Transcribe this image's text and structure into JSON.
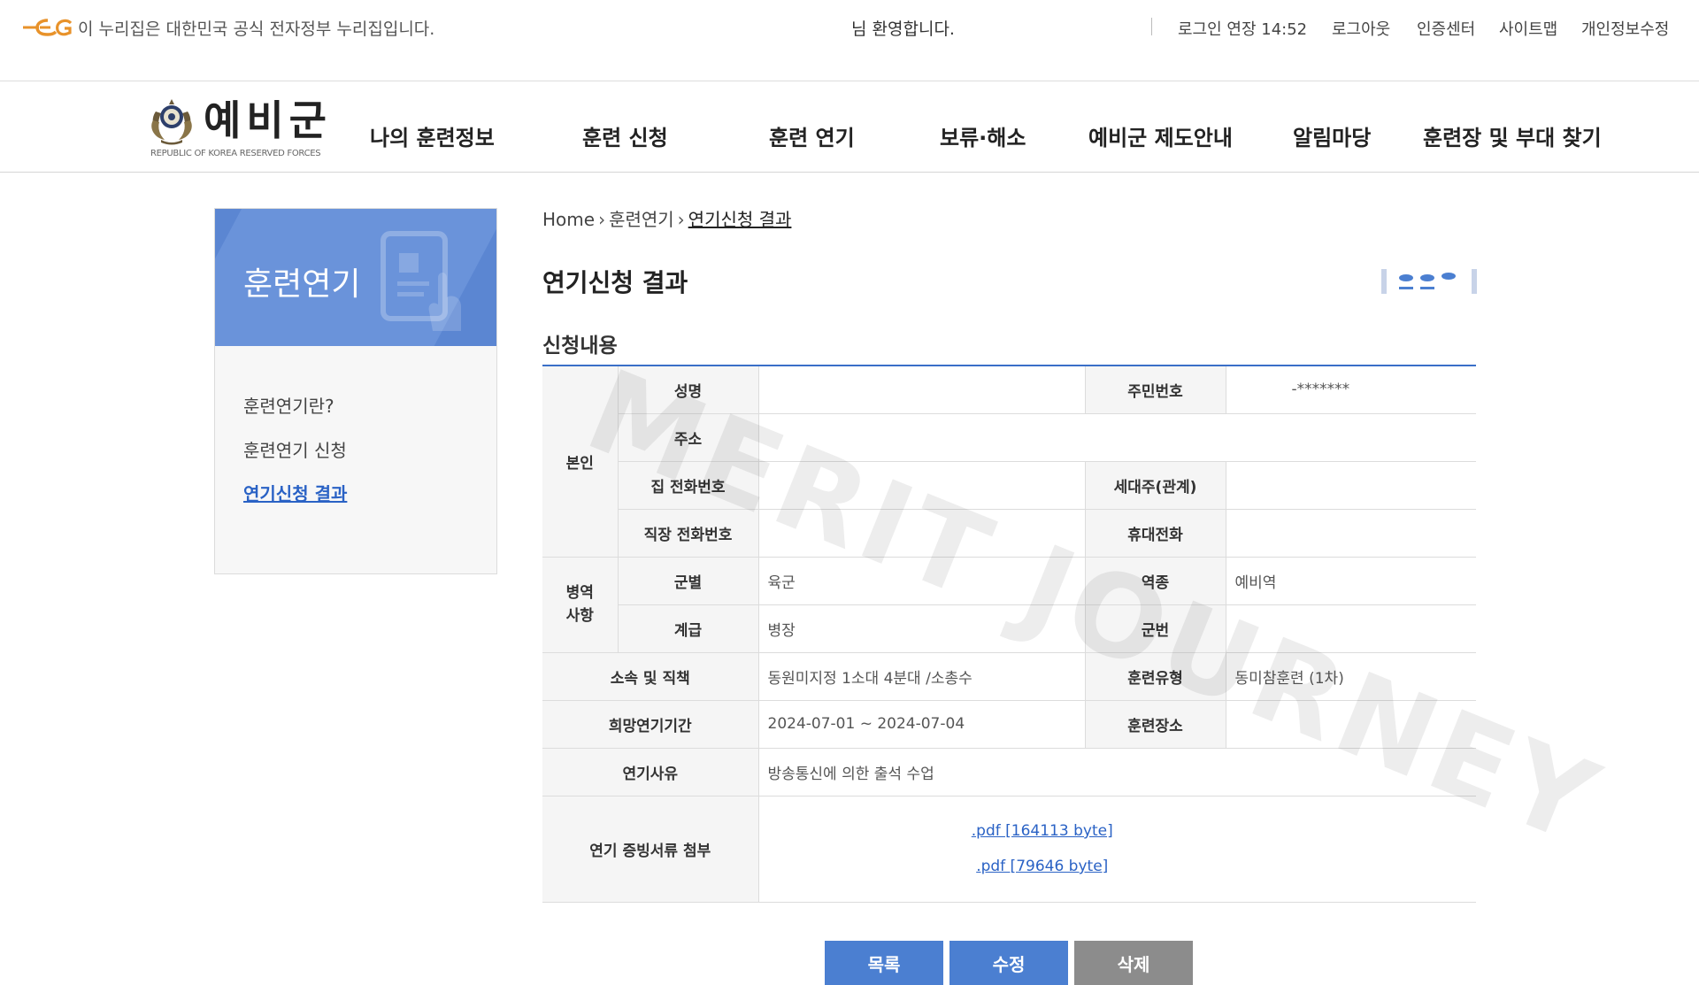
{
  "topbar": {
    "gov_notice": "이 누리집은 대한민국 공식 전자정부 누리집입니다.",
    "welcome": "님 환영합니다.",
    "login_extend": "로그인 연장 14:52",
    "logout": "로그아웃",
    "cert_center": "인증센터",
    "sitemap": "사이트맵",
    "edit_profile": "개인정보수정"
  },
  "brand": {
    "name": "예비군",
    "subtitle": "REPUBLIC OF KOREA RESERVED FORCES"
  },
  "gnb": [
    {
      "label": "나의 훈련정보"
    },
    {
      "label": "훈련 신청"
    },
    {
      "label": "훈련 연기"
    },
    {
      "label": "보류·해소"
    },
    {
      "label": "예비군 제도안내"
    },
    {
      "label": "알림마당"
    },
    {
      "label": "훈련장 및 부대 찾기"
    }
  ],
  "lnb": {
    "title": "훈련연기",
    "items": [
      {
        "label": "훈련연기란?"
      },
      {
        "label": "훈련연기 신청"
      },
      {
        "label": "연기신청 결과"
      }
    ]
  },
  "breadcrumb": {
    "home": "Home",
    "level1": "훈련연기",
    "current": "연기신청 결과"
  },
  "page": {
    "title": "연기신청 결과",
    "section_title": "신청내용"
  },
  "table": {
    "self_label": "본인",
    "name_label": "성명",
    "name_value": "",
    "rrn_label": "주민번호",
    "rrn_value": "-*******",
    "address_label": "주소",
    "address_value": "",
    "home_phone_label": "집 전화번호",
    "home_phone_value": "",
    "householder_label": "세대주(관계)",
    "householder_value": "",
    "work_phone_label": "직장 전화번호",
    "work_phone_value": "",
    "mobile_label": "휴대전화",
    "mobile_value": "",
    "military_label_1": "병역",
    "military_label_2": "사항",
    "branch_label": "군별",
    "branch_value": "육군",
    "service_type_label": "역종",
    "service_type_value": "예비역",
    "rank_label": "계급",
    "rank_value": "병장",
    "service_no_label": "군번",
    "service_no_value": "",
    "unit_label": "소속 및 직책",
    "unit_value": "동원미지정 1소대 4분대 /소총수",
    "training_type_label": "훈련유형",
    "training_type_value": "동미참훈련 (1차)",
    "period_label": "희망연기기간",
    "period_value": "2024-07-01 ~ 2024-07-04",
    "location_label": "훈련장소",
    "location_value": "",
    "reason_label": "연기사유",
    "reason_value": "방송통신에 의한 출석 수업",
    "attachments_label": "연기 증빙서류 첨부",
    "attachments": [
      {
        "label": ".pdf [164113 byte]"
      },
      {
        "label": ".pdf [79646 byte]"
      }
    ]
  },
  "buttons": {
    "list": "목록",
    "edit": "수정",
    "delete": "삭제"
  },
  "watermark": "MERIT JOURNEY",
  "colors": {
    "accent": "#3a6fc8",
    "sidebar_header": "#5b86d2",
    "button_blue": "#4b7fd1",
    "button_gray": "#8c8c8c",
    "link": "#2a62c5",
    "gov_logo": "#e8922a"
  }
}
